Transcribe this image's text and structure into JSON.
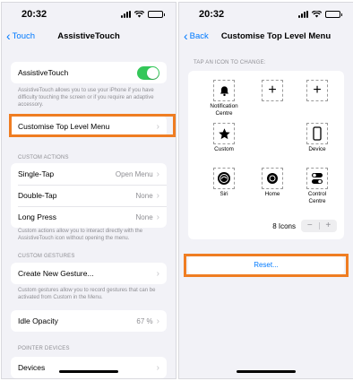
{
  "left": {
    "status": {
      "time": "20:32"
    },
    "nav": {
      "back_label": "Touch",
      "title": "AssistiveTouch"
    },
    "assistive_touch": {
      "label": "AssistiveTouch",
      "enabled": true,
      "footer": "AssistiveTouch allows you to use your iPhone if you have difficulty touching the screen or if you require an adaptive accessory."
    },
    "customise_row": {
      "label": "Customise Top Level Menu"
    },
    "custom_actions": {
      "header": "CUSTOM ACTIONS",
      "rows": [
        {
          "label": "Single-Tap",
          "value": "Open Menu"
        },
        {
          "label": "Double-Tap",
          "value": "None"
        },
        {
          "label": "Long Press",
          "value": "None"
        }
      ],
      "footer": "Custom actions allow you to interact directly with the AssistiveTouch icon without opening the menu."
    },
    "custom_gestures": {
      "header": "CUSTOM GESTURES",
      "create_label": "Create New Gesture...",
      "footer": "Custom gestures allow you to record gestures that can be activated from Custom in the Menu."
    },
    "idle_opacity": {
      "label": "Idle Opacity",
      "value": "67 %"
    },
    "pointer_devices": {
      "header": "POINTER DEVICES",
      "devices_label": "Devices"
    }
  },
  "right": {
    "status": {
      "time": "20:32"
    },
    "nav": {
      "back_label": "Back",
      "title": "Customise Top Level Menu"
    },
    "hint": "TAP AN ICON TO CHANGE:",
    "slots": [
      {
        "icon": "bell-icon",
        "label": "Notification Centre"
      },
      {
        "icon": "plus-icon",
        "label": ""
      },
      {
        "icon": "plus-icon",
        "label": ""
      },
      {
        "icon": "star-icon",
        "label": "Custom"
      },
      {
        "icon": "device-icon",
        "label": "Device"
      },
      {
        "icon": "siri-icon",
        "label": "Siri"
      },
      {
        "icon": "home-icon",
        "label": "Home"
      },
      {
        "icon": "control-centre-icon",
        "label": "Control Centre"
      }
    ],
    "icons_count": "8 Icons",
    "stepper": {
      "minus": "−",
      "plus": "+"
    },
    "reset_label": "Reset..."
  },
  "colors": {
    "accent": "#007aff",
    "toggle_on": "#34c759",
    "highlight": "#ef7d22",
    "background": "#f2f2f7"
  }
}
